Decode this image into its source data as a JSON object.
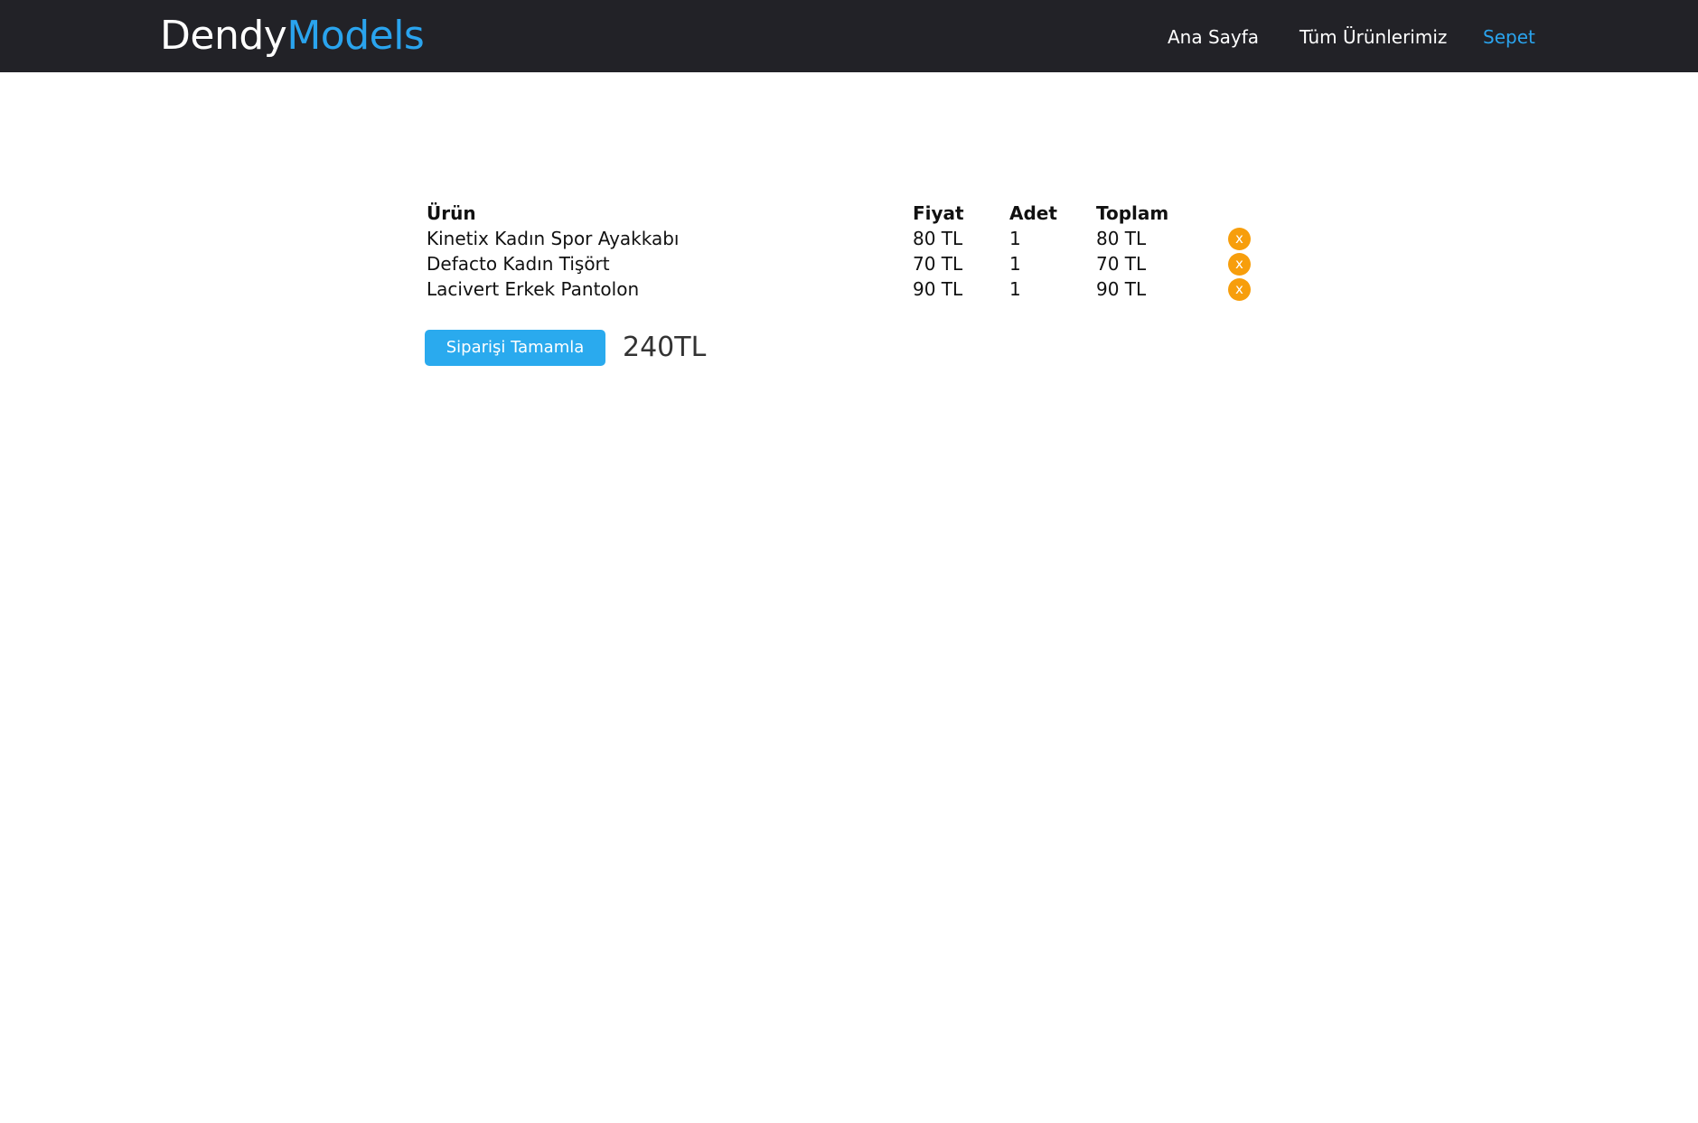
{
  "brand": {
    "part1": "Dendy",
    "part2": "Models"
  },
  "nav": {
    "home": "Ana Sayfa",
    "all_products": "Tüm Ürünlerimiz",
    "cart": "Sepet"
  },
  "table": {
    "headers": {
      "product": "Ürün",
      "price": "Fiyat",
      "quantity": "Adet",
      "total": "Toplam"
    },
    "rows": [
      {
        "product": "Kinetix Kadın Spor Ayakkabı",
        "price": "80 TL",
        "quantity": "1",
        "total": "80 TL",
        "remove": "x"
      },
      {
        "product": "Defacto Kadın Tişört",
        "price": "70 TL",
        "quantity": "1",
        "total": "70 TL",
        "remove": "x"
      },
      {
        "product": "Lacivert Erkek Pantolon",
        "price": "90 TL",
        "quantity": "1",
        "total": "90 TL",
        "remove": "x"
      }
    ]
  },
  "checkout": {
    "button_label": "Siparişi Tamamla",
    "grand_total": "240TL"
  },
  "colors": {
    "navbar_bg": "#222227",
    "accent": "#2aa4ee",
    "remove_button": "#f79e0c"
  }
}
